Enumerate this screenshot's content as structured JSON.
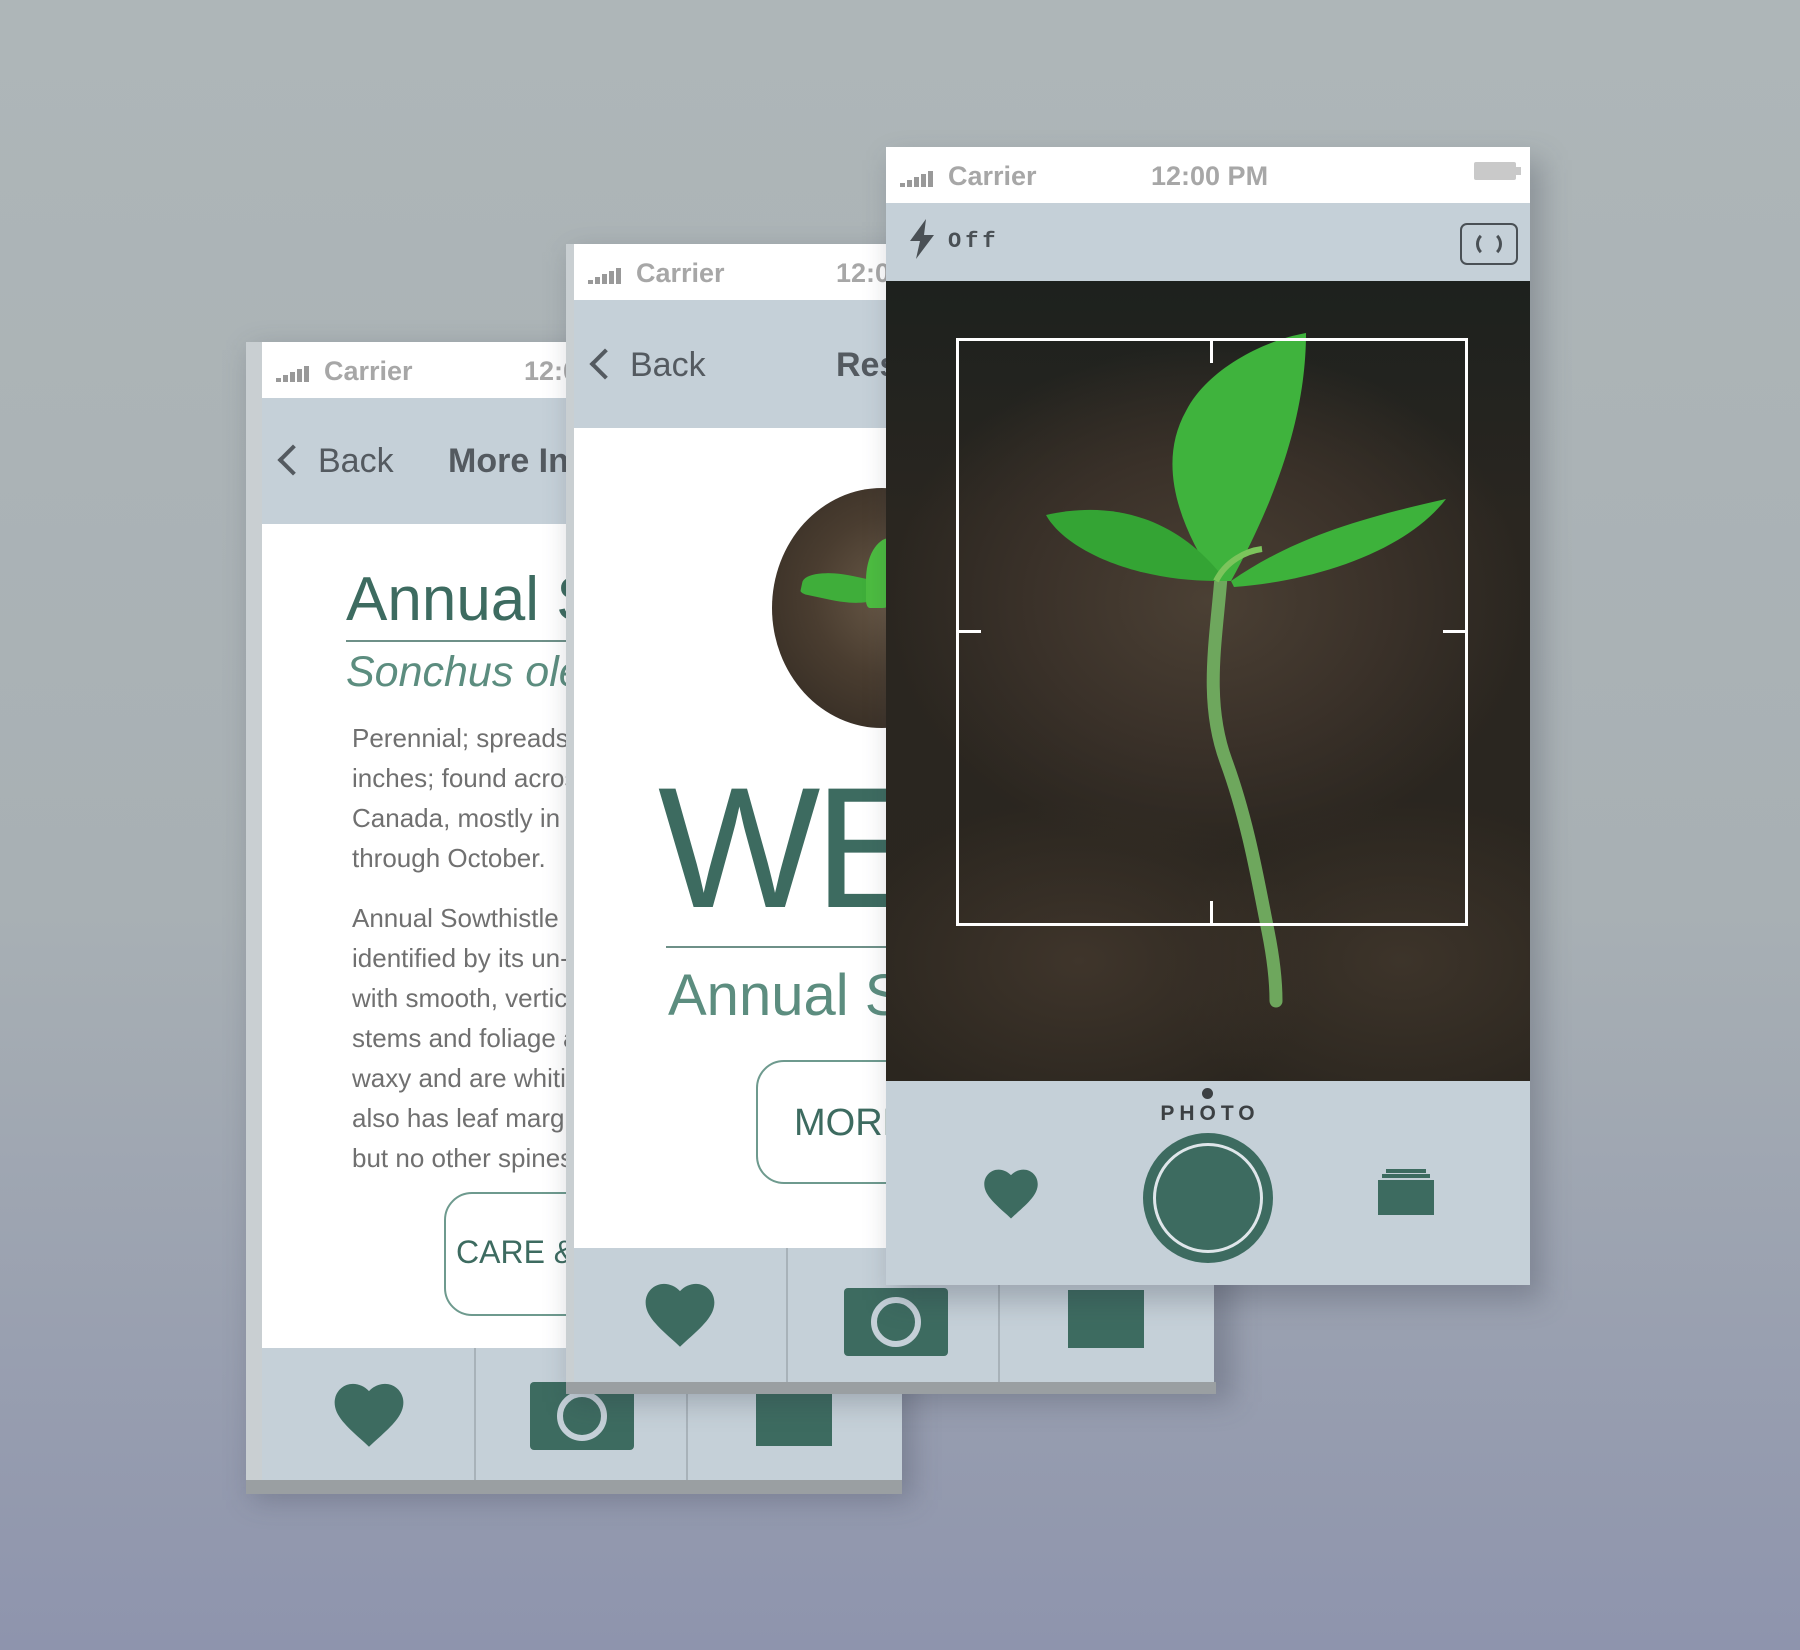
{
  "status_bar": {
    "carrier": "Carrier",
    "time": "12:00 PM",
    "time_short": "12:0"
  },
  "screen_more_info": {
    "back_label": "Back",
    "nav_title": "More In",
    "heading": "Annual S",
    "subtitle": "Sonchus ole",
    "paragraph1": [
      "Perennial; spreads b",
      "inches; found acros",
      "Canada, mostly in la",
      "through October."
    ],
    "paragraph2": [
      "Annual Sowthistle is",
      "identified by its un-b",
      "with smooth, vertica",
      "stems and foliage a",
      "waxy and are whitis",
      "also has leaf margin",
      "but no other spines"
    ],
    "button_label": "CARE &"
  },
  "screen_result": {
    "back_label": "Back",
    "nav_title": "Res",
    "big_word": "WE",
    "common_name": "Annual S",
    "button_label": "MORE"
  },
  "screen_camera": {
    "flash_label": "Off",
    "mode_label": "PHOTO"
  },
  "tab_icons": [
    "heart-icon",
    "camera-icon",
    "gallery-icon"
  ],
  "colors": {
    "accent": "#3d6b60",
    "bar": "#c5d0d8",
    "text_gray": "#545a60"
  }
}
